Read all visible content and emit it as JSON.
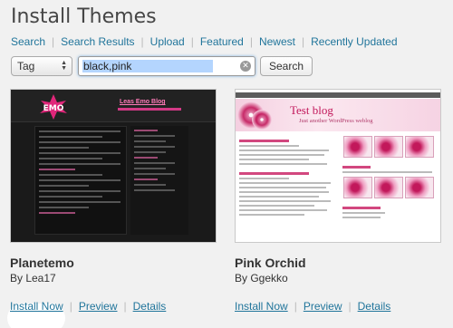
{
  "page": {
    "title": "Install Themes"
  },
  "subnav": [
    {
      "label": "Search"
    },
    {
      "label": "Search Results"
    },
    {
      "label": "Upload"
    },
    {
      "label": "Featured"
    },
    {
      "label": "Newest"
    },
    {
      "label": "Recently Updated"
    }
  ],
  "search": {
    "type_selected": "Tag",
    "query": "black,pink",
    "button_label": "Search"
  },
  "themes": [
    {
      "name": "Planetemo",
      "author": "By Lea17",
      "actions": {
        "install": "Install Now",
        "preview": "Preview",
        "details": "Details"
      },
      "preview": {
        "site_title": "Leas Emo Blog"
      }
    },
    {
      "name": "Pink Orchid",
      "author": "By Ggekko",
      "actions": {
        "install": "Install Now",
        "preview": "Preview",
        "details": "Details"
      },
      "preview": {
        "site_title": "Test blog",
        "tagline": "Just another WordPress weblog"
      }
    }
  ],
  "colors": {
    "link": "#21759b",
    "background": "#f1f1f1",
    "pink_accent": "#c2185b"
  }
}
